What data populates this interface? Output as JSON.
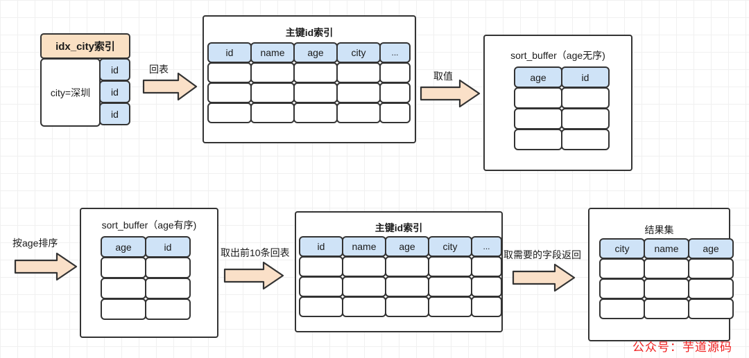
{
  "diagram": {
    "title": "MySQL order by sort_buffer flow",
    "watermark": "公众号：芋道源码",
    "colors": {
      "header_cell": "#cfe3f7",
      "banner": "#fae0c3",
      "arrow_fill": "#fae0c8",
      "border": "#333333",
      "watermark": "#f02020",
      "grid": "#f0f0f0"
    }
  },
  "idx_city_index": {
    "title": "idx_city索引",
    "condition": "city=深圳",
    "ids": [
      "id",
      "id",
      "id"
    ]
  },
  "arrows": {
    "back_to_table": "回表",
    "fetch_value": "取值",
    "sort_by_age": "按age排序",
    "take_first_10": "取出前10条回表",
    "return_needed_fields": "取需要的字段返回"
  },
  "pk_index_top": {
    "title": "主键id索引",
    "columns": [
      "id",
      "name",
      "age",
      "city",
      "..."
    ],
    "row_count": 3
  },
  "sort_buffer_unsorted": {
    "title": "sort_buffer（age无序)",
    "columns": [
      "age",
      "id"
    ],
    "row_count": 3
  },
  "sort_buffer_sorted": {
    "title": "sort_buffer（age有序)",
    "columns": [
      "age",
      "id"
    ],
    "row_count": 3
  },
  "pk_index_bottom": {
    "title": "主键id索引",
    "columns": [
      "id",
      "name",
      "age",
      "city",
      "..."
    ],
    "row_count": 3
  },
  "result_set": {
    "title": "结果集",
    "columns": [
      "city",
      "name",
      "age"
    ],
    "row_count": 3
  }
}
